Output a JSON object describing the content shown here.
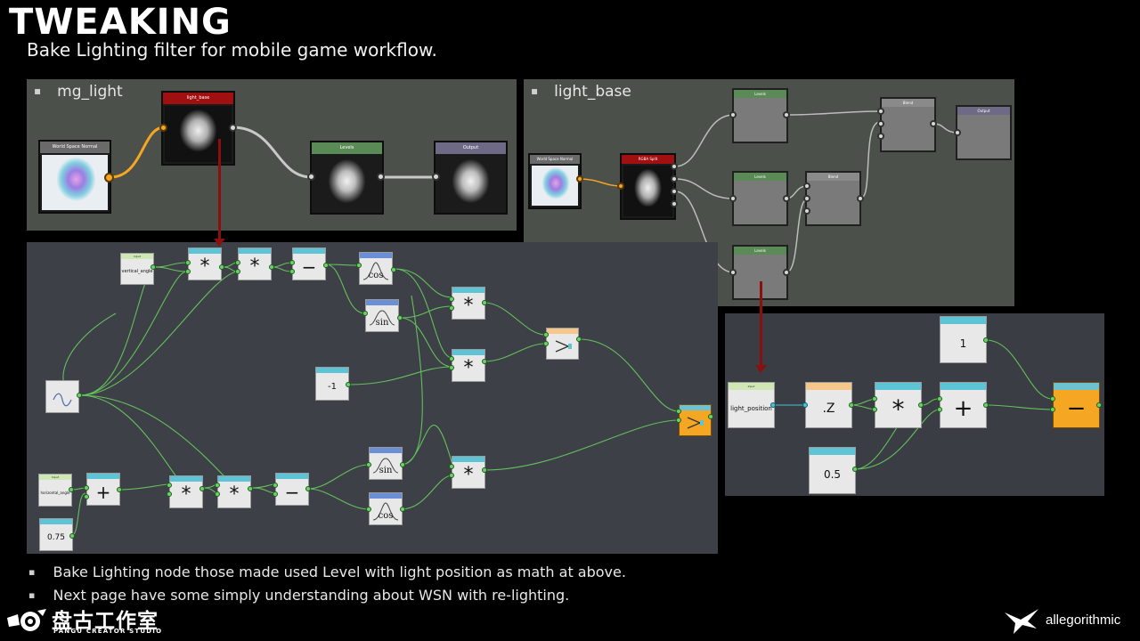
{
  "slide": {
    "title": "TWEAKING",
    "subtitle": "Bake Lighting filter for mobile game workflow."
  },
  "panels": {
    "mg_light": {
      "label": "mg_light",
      "nodes": {
        "world_space_normal": "World Space Normal",
        "light_base": "light_base",
        "levels": "Levels",
        "output": "Output"
      }
    },
    "light_base": {
      "label": "light_base",
      "nodes": {
        "world_space_normal": "World Space Normal",
        "rgba_split": "RGBA Split",
        "levels_top": "Levels",
        "levels_mid": "Levels",
        "levels_bottom": "Levels",
        "blend_top": "Blend",
        "blend_mid": "Blend",
        "output": "Output"
      }
    },
    "function_graph": {
      "vertical_angle_value": "vertical_angle",
      "horizontal_angle_value": "horizontal_angle",
      "multiply_symbol": "*",
      "subtract_symbol": "−",
      "add_symbol": "+",
      "cos_symbol": "cos",
      "sin_symbol": "sin",
      "minus_one_value": "-1",
      "scale_value": "0.75"
    },
    "light_position_graph": {
      "light_position_value": "light_position",
      "swizzle_value": ".Z",
      "multiply_symbol": "*",
      "add_symbol": "+",
      "subtract_symbol": "−",
      "one_value": "1",
      "half_value": "0.5"
    }
  },
  "bullets": [
    "Bake Lighting node those made used Level with light position as math at above.",
    "Next page have some simply understanding about WSN with re-lighting."
  ],
  "logos": {
    "left_cn": "盘古工作室",
    "left_en": "PANGU CREATOR STUDIO",
    "right": "allegorithmic"
  },
  "colors": {
    "accent_arrow": "#8a0f0f",
    "light_base_header": "#a01010",
    "levels_header": "#5a8a56",
    "output_header": "#6e6a85",
    "result_node": "#f5a623"
  }
}
